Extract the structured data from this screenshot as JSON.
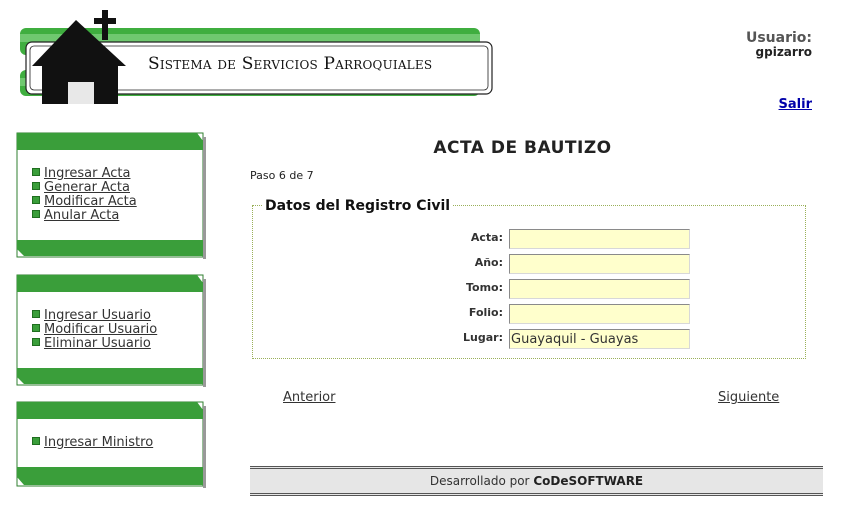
{
  "header": {
    "system_title": "Sistema de Servicios Parroquiales",
    "user_label": "Usuario:",
    "user_name": "gpizarro",
    "logout_label": "Salir"
  },
  "sidebar": {
    "groups": [
      {
        "items": [
          "Ingresar Acta",
          "Generar Acta",
          "Modificar Acta",
          "Anular Acta"
        ]
      },
      {
        "items": [
          "Ingresar Usuario",
          "Modificar Usuario",
          "Eliminar Usuario"
        ]
      },
      {
        "items": [
          "Ingresar Ministro"
        ]
      }
    ]
  },
  "main": {
    "title": "ACTA DE BAUTIZO",
    "step_text": "Paso 6 de 7",
    "section_legend": "Datos del Registro Civil",
    "fields": [
      {
        "label": "Acta:",
        "value": ""
      },
      {
        "label": "Año:",
        "value": ""
      },
      {
        "label": "Tomo:",
        "value": ""
      },
      {
        "label": "Folio:",
        "value": ""
      },
      {
        "label": "Lugar:",
        "value": "Guayaquil - Guayas"
      }
    ],
    "prev_label": "Anterior",
    "next_label": "Siguiente"
  },
  "footer": {
    "prefix": "Desarrollado por",
    "company": "CoDeSOFTWARE"
  },
  "colors": {
    "brand_green": "#3a9e3a",
    "input_background": "#ffffcc",
    "link_blue": "#0000aa"
  }
}
